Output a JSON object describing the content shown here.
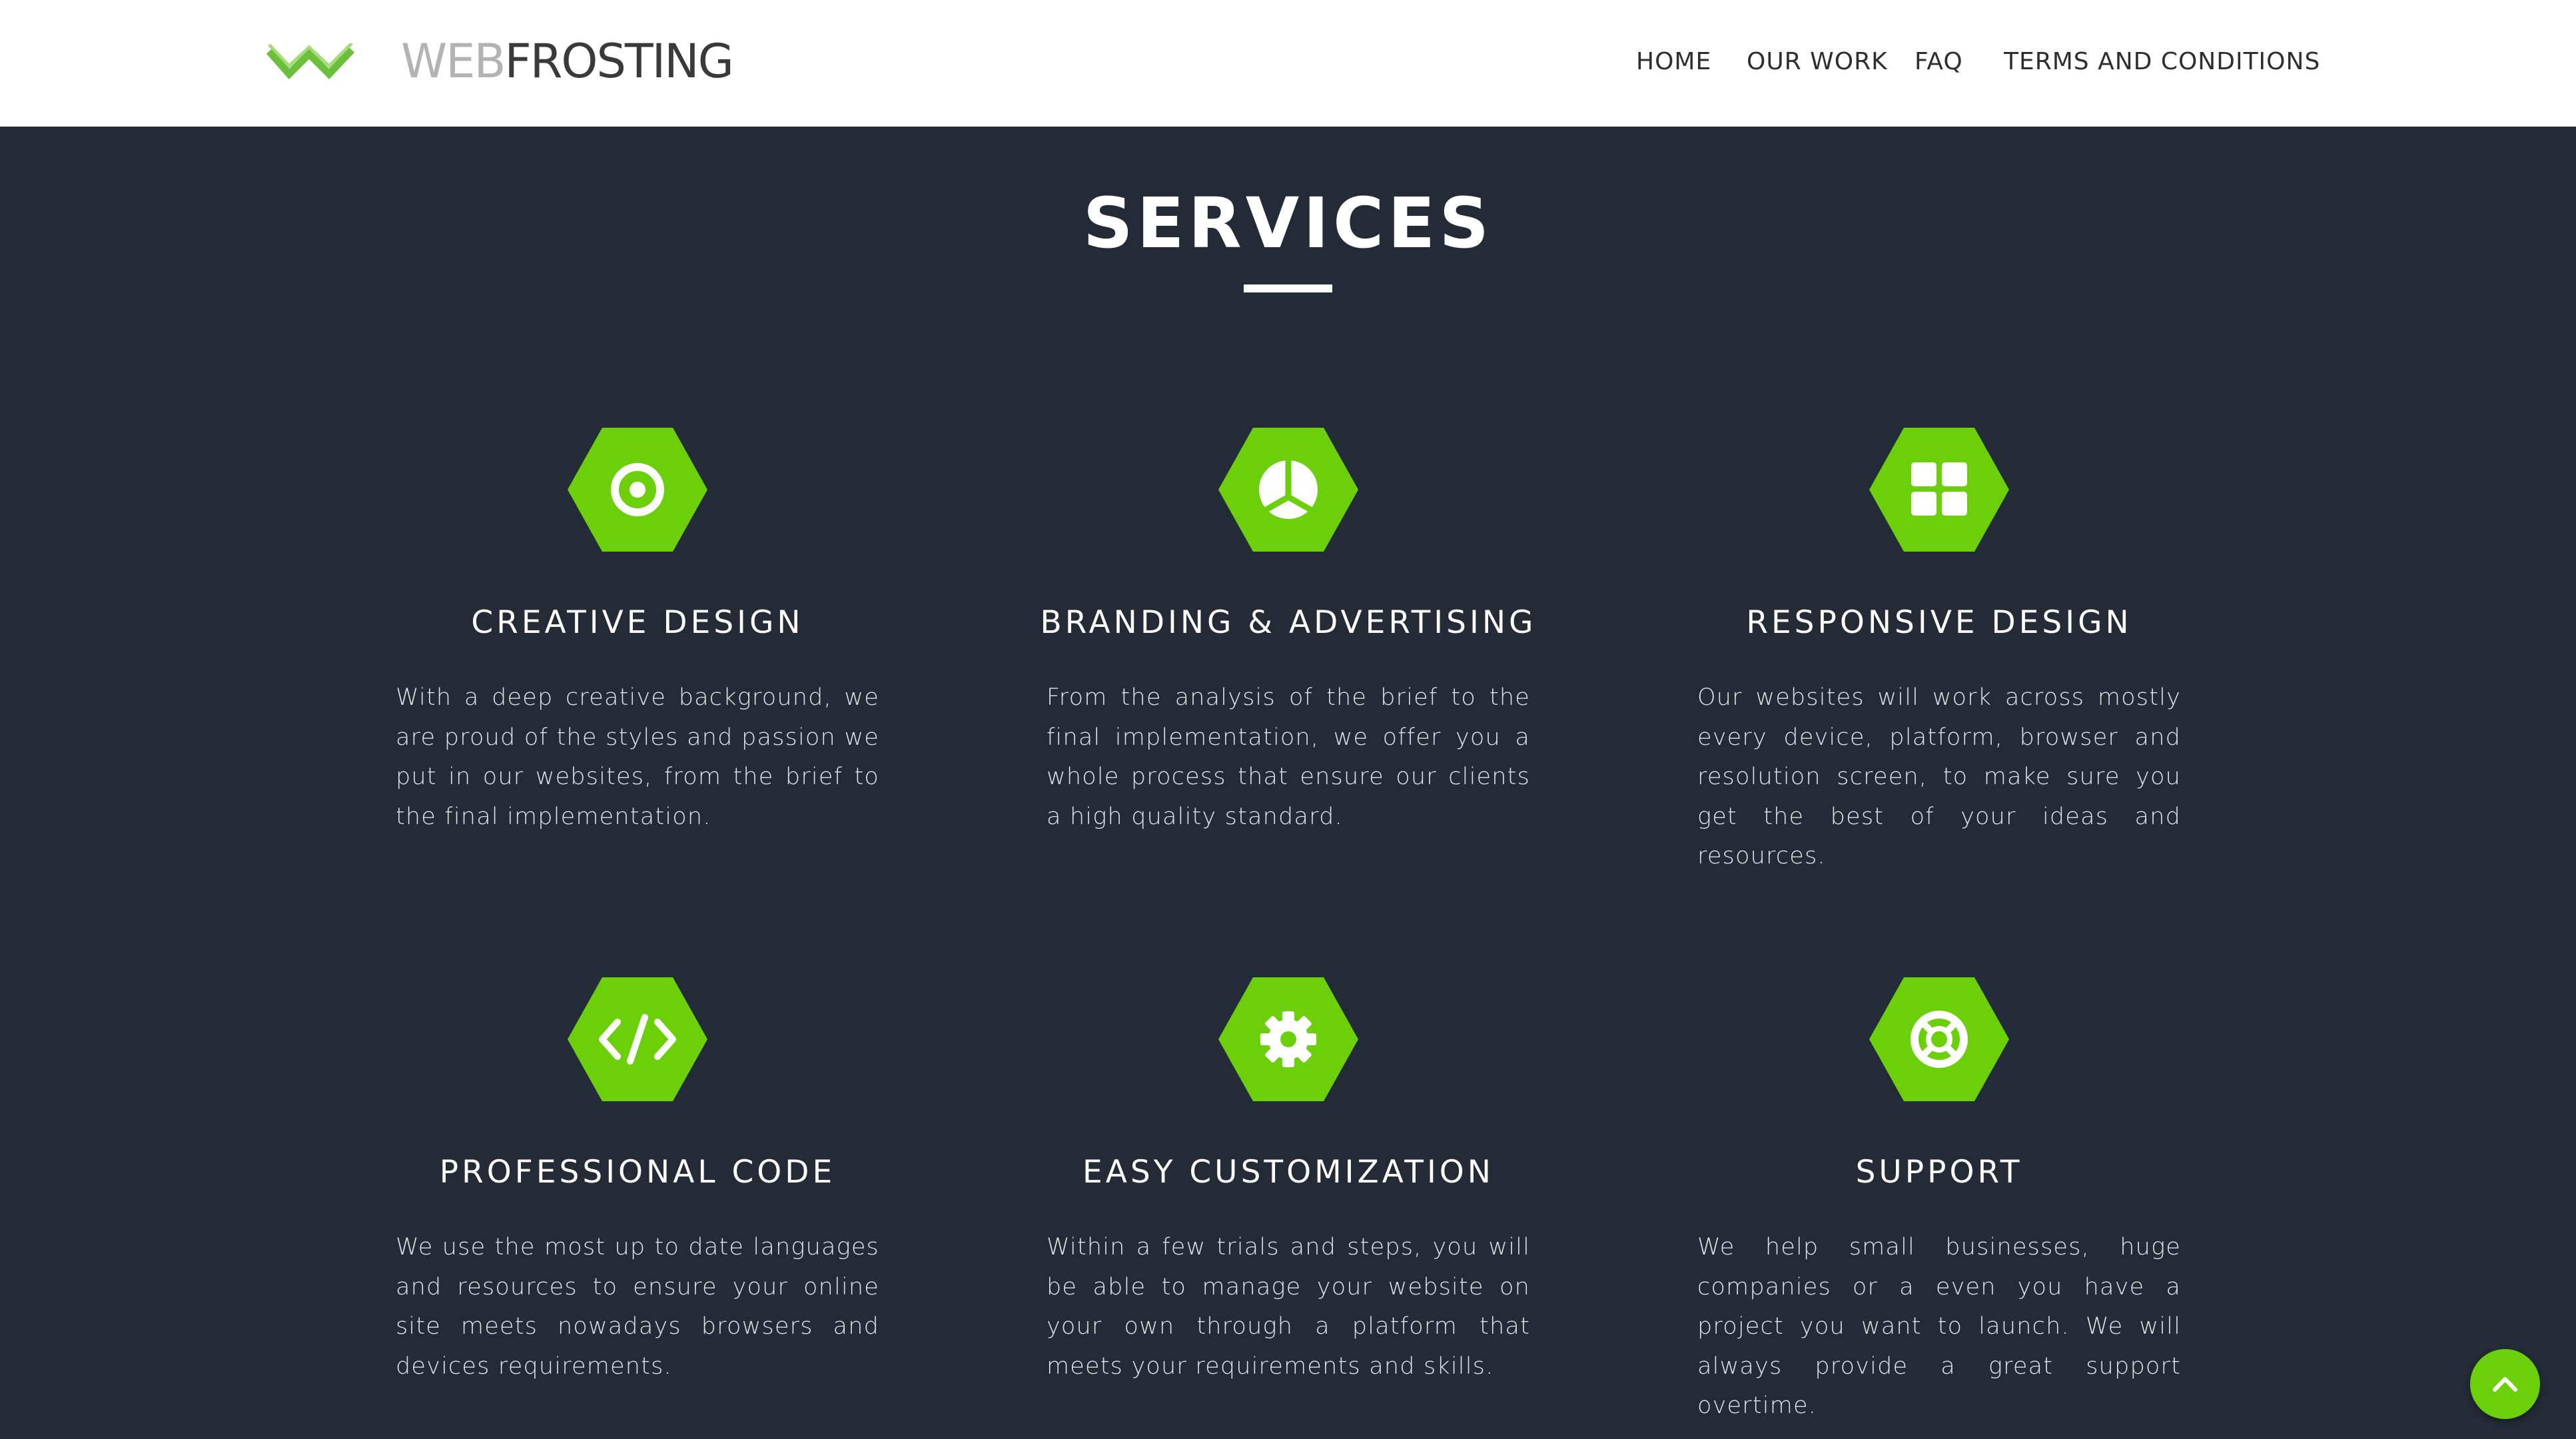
{
  "header": {
    "logo_prefix": "WEB",
    "logo_suffix": "FROSTING",
    "nav": [
      "HOME",
      "OUR WORK",
      "FAQ",
      "TERMS AND CONDITIONS"
    ]
  },
  "colors": {
    "accent": "#6bd00a",
    "background": "#232b36",
    "header_bg": "#ffffff"
  },
  "section": {
    "title": "SERVICES"
  },
  "services": [
    {
      "icon": "target-icon",
      "title": "CREATIVE DESIGN",
      "text": "With a deep creative background, we are proud of the styles and passion we put in our websites, from the brief to the final implementation."
    },
    {
      "icon": "peace-icon",
      "title": "BRANDING & ADVERTISING",
      "text": "From the analysis of the brief to the final implementation, we offer you a whole process that ensure our clients a high quality standard."
    },
    {
      "icon": "grid-icon",
      "title": "RESPONSIVE DESIGN",
      "text": "Our websites will work across mostly every device, platform, browser and resolution screen, to make sure you get the best of your ideas and resources."
    },
    {
      "icon": "code-icon",
      "title": "PROFESSIONAL CODE",
      "text": "We use the most up to date languages and resources to ensure your online site meets nowadays browsers and devices requirements."
    },
    {
      "icon": "gear-icon",
      "title": "EASY CUSTOMIZATION",
      "text": "Within a few trials and steps, you will be able to manage your website on your own through a platform that meets your requirements and skills."
    },
    {
      "icon": "lifebuoy-icon",
      "title": "SUPPORT",
      "text": "We help small businesses, huge companies or a even you have a project you want to launch. We will always provide a great support overtime."
    }
  ],
  "back_to_top": {
    "icon": "chevron-up-icon"
  }
}
